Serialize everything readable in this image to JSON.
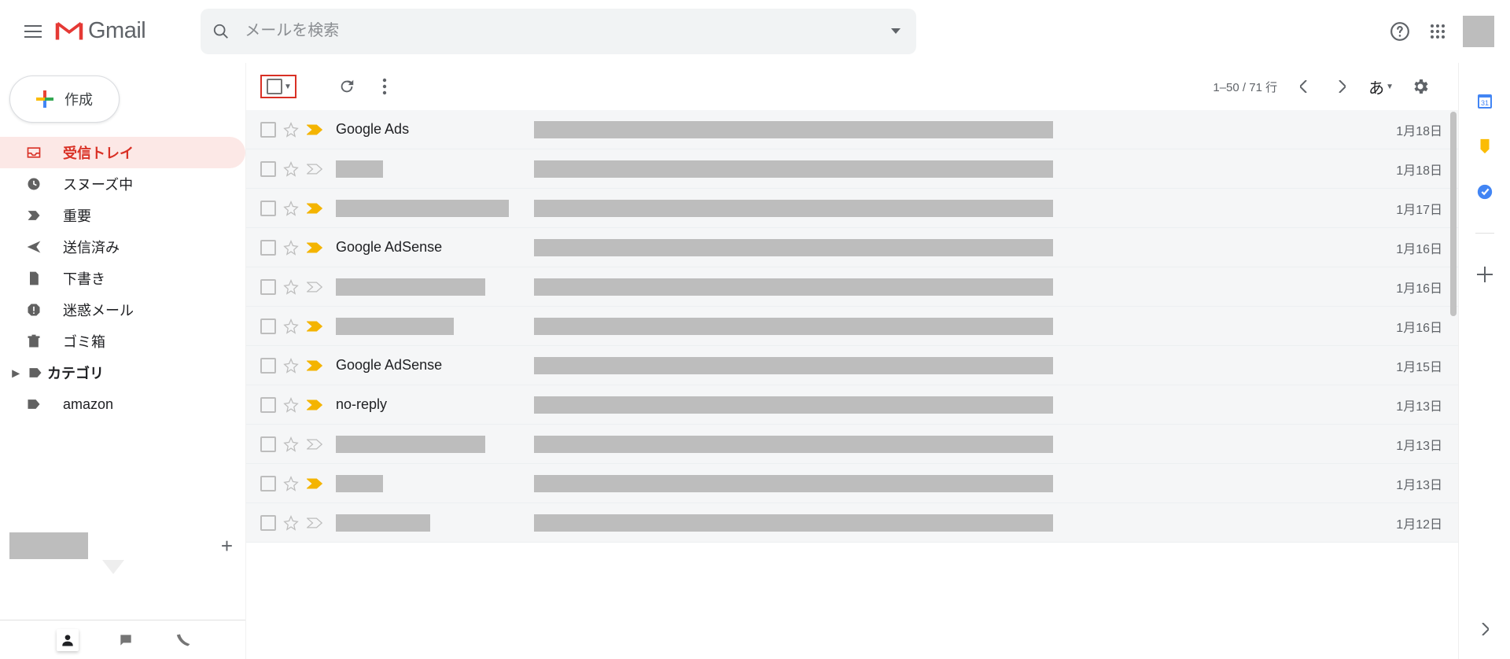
{
  "header": {
    "product_name": "Gmail",
    "search_placeholder": "メールを検索"
  },
  "compose_label": "作成",
  "sidebar": {
    "items": [
      {
        "id": "inbox",
        "label": "受信トレイ",
        "icon": "inbox",
        "active": true
      },
      {
        "id": "snoozed",
        "label": "スヌーズ中",
        "icon": "clock",
        "active": false
      },
      {
        "id": "important",
        "label": "重要",
        "icon": "important",
        "active": false
      },
      {
        "id": "sent",
        "label": "送信済み",
        "icon": "send",
        "active": false
      },
      {
        "id": "drafts",
        "label": "下書き",
        "icon": "file",
        "active": false
      },
      {
        "id": "spam",
        "label": "迷惑メール",
        "icon": "spam",
        "active": false
      },
      {
        "id": "trash",
        "label": "ゴミ箱",
        "icon": "trash",
        "active": false
      },
      {
        "id": "category",
        "label": "カテゴリ",
        "icon": "label",
        "active": false,
        "bold": true,
        "expandable": true
      },
      {
        "id": "amazon",
        "label": "amazon",
        "icon": "label",
        "active": false
      }
    ]
  },
  "toolbar": {
    "page_text": "1–50 / 71 行",
    "input_tool_label": "あ"
  },
  "rows": [
    {
      "sender": "Google Ads",
      "sender_redact_w": 0,
      "important_color": "yellow",
      "date": "1月18日"
    },
    {
      "sender": "",
      "sender_redact_w": 60,
      "important_color": "gray",
      "date": "1月18日"
    },
    {
      "sender": "",
      "sender_redact_w": 220,
      "important_color": "yellow",
      "date": "1月17日"
    },
    {
      "sender": "Google AdSense",
      "sender_redact_w": 0,
      "important_color": "yellow",
      "date": "1月16日"
    },
    {
      "sender": "",
      "sender_redact_w": 190,
      "important_color": "gray",
      "date": "1月16日"
    },
    {
      "sender": "",
      "sender_redact_w": 150,
      "important_color": "yellow",
      "date": "1月16日"
    },
    {
      "sender": "Google AdSense",
      "sender_redact_w": 0,
      "important_color": "yellow",
      "date": "1月15日"
    },
    {
      "sender": "no-reply",
      "sender_redact_w": 0,
      "important_color": "yellow",
      "date": "1月13日"
    },
    {
      "sender": "",
      "sender_redact_w": 190,
      "important_color": "gray",
      "date": "1月13日"
    },
    {
      "sender": "",
      "sender_redact_w": 60,
      "important_color": "yellow",
      "date": "1月13日"
    },
    {
      "sender": "",
      "sender_redact_w": 120,
      "important_color": "gray",
      "date": "1月12日"
    }
  ]
}
